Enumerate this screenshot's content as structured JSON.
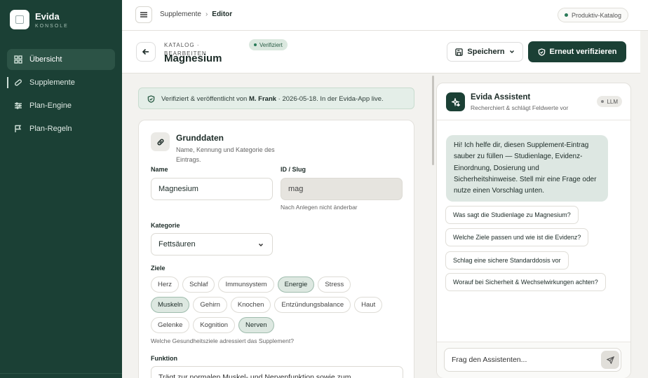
{
  "brand": {
    "name": "Evida",
    "sub": "KONSOLE"
  },
  "nav": [
    {
      "label": "Übersicht",
      "icon": "grid-icon"
    },
    {
      "label": "Supplemente",
      "icon": "pill-icon"
    },
    {
      "label": "Plan-Engine",
      "icon": "sliders-icon"
    },
    {
      "label": "Plan-Regeln",
      "icon": "flag-icon"
    }
  ],
  "topbar": {
    "crumb1": "Supplemente",
    "crumb2": "Editor",
    "env": "Produktiv-Katalog"
  },
  "header": {
    "eyebrow": "KATALOG · BEARBEITEN",
    "title": "Magnesium",
    "badge": "Verifiziert",
    "save": "Speichern",
    "verify": "Erneut verifizieren"
  },
  "notice": {
    "prefix": "Verifiziert & veröffentlicht von ",
    "user": "M. Frank",
    "suffix": " · 2026-05-18. In der Evida-App live."
  },
  "card": {
    "title": "Grunddaten",
    "subtitle": "Name, Kennung und Kategorie des Eintrags.",
    "name_label": "Name",
    "name_value": "Magnesium",
    "id_label": "ID / Slug",
    "id_value": "mag",
    "id_hint": "Nach Anlegen nicht änderbar",
    "category_label": "Kategorie",
    "category_value": "Fettsäuren",
    "goals_label": "Ziele",
    "goals_rows": [
      [
        {
          "label": "Herz",
          "selected": false
        },
        {
          "label": "Schlaf",
          "selected": false
        },
        {
          "label": "Immunsystem",
          "selected": false
        },
        {
          "label": "Energie",
          "selected": true
        },
        {
          "label": "Stress",
          "selected": false
        }
      ],
      [
        {
          "label": "Muskeln",
          "selected": true
        },
        {
          "label": "Gehirn",
          "selected": false
        },
        {
          "label": "Knochen",
          "selected": false
        },
        {
          "label": "Entzündungsbalance",
          "selected": false
        },
        {
          "label": "Haut",
          "selected": false
        }
      ],
      [
        {
          "label": "Gelenke",
          "selected": false
        },
        {
          "label": "Kognition",
          "selected": false
        },
        {
          "label": "Nerven",
          "selected": true
        }
      ]
    ],
    "goals_hint": "Welche Gesundheitsziele adressiert das Supplement?",
    "function_label": "Funktion",
    "function_value": "Trägt zur normalen Muskel- und Nervenfunktion sowie zum"
  },
  "assistant": {
    "name": "Evida Assistent",
    "sub": "Recherchiert & schlägt Feldwerte vor",
    "llm": "LLM",
    "greeting": "Hi! Ich helfe dir, diesen Supplement-Eintrag sauber zu füllen — Studienlage, Evidenz-Einordnung, Dosierung und Sicherheitshinweise. Stell mir eine Frage oder nutze einen Vorschlag unten.",
    "suggestions": [
      "Was sagt die Studienlage zu Magnesium?",
      "Welche Ziele passen und wie ist die Evidenz?",
      "Schlag eine sichere Standarddosis vor",
      "Worauf bei Sicherheit & Wechselwirkungen achten?"
    ],
    "placeholder": "Frag den Assistenten..."
  }
}
